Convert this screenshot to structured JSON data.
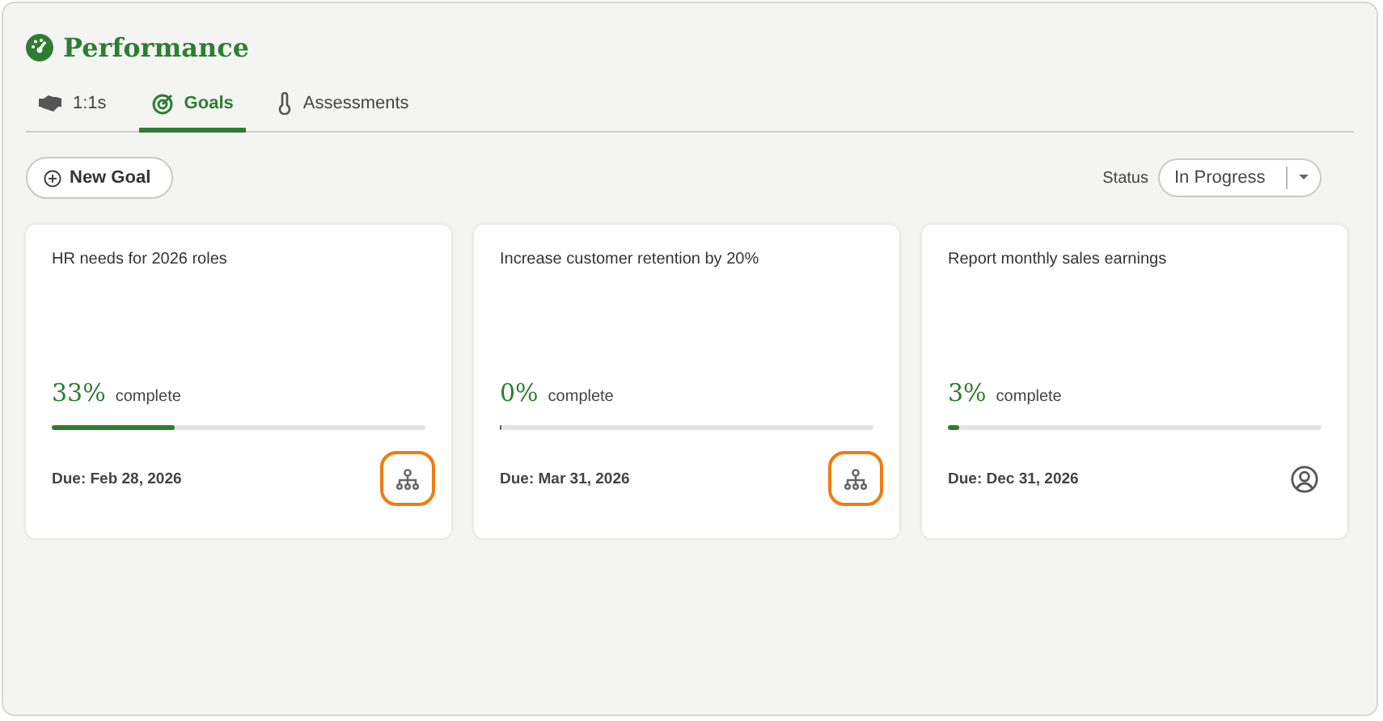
{
  "header": {
    "title": "Performance"
  },
  "tabs": [
    {
      "label": "1:1s",
      "selected": false
    },
    {
      "label": "Goals",
      "selected": true
    },
    {
      "label": "Assessments",
      "selected": false
    }
  ],
  "new_goal_button": "New Goal",
  "status_filter": {
    "label": "Status",
    "value": "In Progress"
  },
  "goals": [
    {
      "title": "HR needs for 2026 roles",
      "percent": "33%",
      "complete_label": "complete",
      "level": 0.33,
      "due": "Due: Feb 28, 2026",
      "kind": "team",
      "highlighted": true
    },
    {
      "title": "Increase customer retention by 20%",
      "percent": "0%",
      "complete_label": "complete",
      "level": 0,
      "due": "Due: Mar 31, 2026",
      "kind": "team",
      "highlighted": true
    },
    {
      "title": "Report monthly sales earnings",
      "percent": "3%",
      "complete_label": "complete",
      "level": 0.03,
      "due": "Due: Dec 31, 2026",
      "kind": "person",
      "highlighted": false
    }
  ]
}
